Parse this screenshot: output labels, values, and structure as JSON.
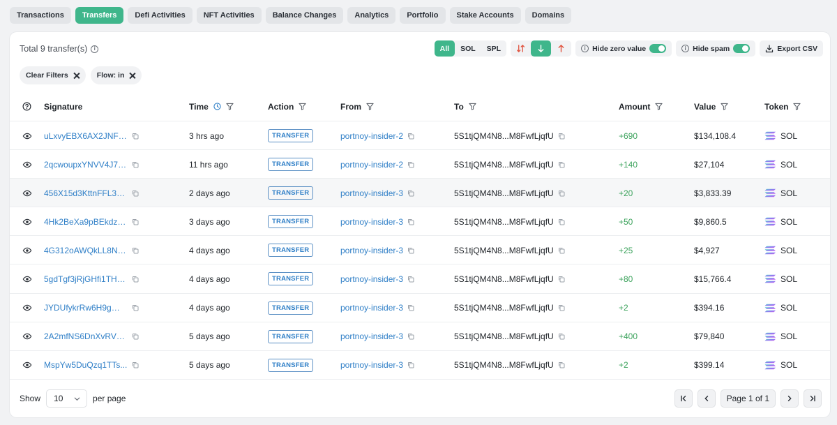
{
  "tabs": [
    {
      "label": "Transactions",
      "active": false
    },
    {
      "label": "Transfers",
      "active": true
    },
    {
      "label": "Defi Activities",
      "active": false
    },
    {
      "label": "NFT Activities",
      "active": false
    },
    {
      "label": "Balance Changes",
      "active": false
    },
    {
      "label": "Analytics",
      "active": false
    },
    {
      "label": "Portfolio",
      "active": false
    },
    {
      "label": "Stake Accounts",
      "active": false
    },
    {
      "label": "Domains",
      "active": false
    }
  ],
  "summary": {
    "total_text": "Total 9 transfer(s)"
  },
  "toolbar": {
    "token_filter": {
      "all": "All",
      "sol": "SOL",
      "spl": "SPL",
      "selected": "All"
    },
    "direction_selected": "in",
    "hide_zero_label": "Hide zero value",
    "hide_zero_on": true,
    "hide_spam_label": "Hide spam",
    "hide_spam_on": true,
    "export_label": "Export CSV"
  },
  "filters": {
    "clear_label": "Clear Filters",
    "active_filter": "Flow: in"
  },
  "table": {
    "headers": {
      "signature": "Signature",
      "time": "Time",
      "action": "Action",
      "from": "From",
      "to": "To",
      "amount": "Amount",
      "value": "Value",
      "token": "Token"
    },
    "rows": [
      {
        "signature": "uLxvyEBX6AX2JNFp...",
        "time": "3 hrs ago",
        "action": "TRANSFER",
        "from": "portnoy-insider-2",
        "to": "5S1tjQM4N8...M8FwfLjqfU",
        "amount": "+690",
        "value": "$134,108.4",
        "token": "SOL"
      },
      {
        "signature": "2qcwoupxYNVV4J7L...",
        "time": "11 hrs ago",
        "action": "TRANSFER",
        "from": "portnoy-insider-2",
        "to": "5S1tjQM4N8...M8FwfLjqfU",
        "amount": "+140",
        "value": "$27,104",
        "token": "SOL"
      },
      {
        "signature": "456X15d3KttnFFL3k...",
        "time": "2 days ago",
        "action": "TRANSFER",
        "from": "portnoy-insider-3",
        "to": "5S1tjQM4N8...M8FwfLjqfU",
        "amount": "+20",
        "value": "$3,833.39",
        "token": "SOL"
      },
      {
        "signature": "4Hk2BeXa9pBEkdzF...",
        "time": "3 days ago",
        "action": "TRANSFER",
        "from": "portnoy-insider-3",
        "to": "5S1tjQM4N8...M8FwfLjqfU",
        "amount": "+50",
        "value": "$9,860.5",
        "token": "SOL"
      },
      {
        "signature": "4G312oAWQkLL8NYi...",
        "time": "4 days ago",
        "action": "TRANSFER",
        "from": "portnoy-insider-3",
        "to": "5S1tjQM4N8...M8FwfLjqfU",
        "amount": "+25",
        "value": "$4,927",
        "token": "SOL"
      },
      {
        "signature": "5gdTgf3jRjGHfi1THs...",
        "time": "4 days ago",
        "action": "TRANSFER",
        "from": "portnoy-insider-3",
        "to": "5S1tjQM4N8...M8FwfLjqfU",
        "amount": "+80",
        "value": "$15,766.4",
        "token": "SOL"
      },
      {
        "signature": "JYDUfykrRw6H9gWv...",
        "time": "4 days ago",
        "action": "TRANSFER",
        "from": "portnoy-insider-3",
        "to": "5S1tjQM4N8...M8FwfLjqfU",
        "amount": "+2",
        "value": "$394.16",
        "token": "SOL"
      },
      {
        "signature": "2A2mfNS6DnXvRVFJ...",
        "time": "5 days ago",
        "action": "TRANSFER",
        "from": "portnoy-insider-3",
        "to": "5S1tjQM4N8...M8FwfLjqfU",
        "amount": "+400",
        "value": "$79,840",
        "token": "SOL"
      },
      {
        "signature": "MspYw5DuQzq1TTs...",
        "time": "5 days ago",
        "action": "TRANSFER",
        "from": "portnoy-insider-3",
        "to": "5S1tjQM4N8...M8FwfLjqfU",
        "amount": "+2",
        "value": "$399.14",
        "token": "SOL"
      }
    ]
  },
  "footer": {
    "show_label": "Show",
    "page_size": "10",
    "per_page_label": "per page",
    "page_info": "Page 1 of 1"
  },
  "colors": {
    "accent": "#3fb68b",
    "link": "#2f7fc7",
    "positive": "#3da35d"
  }
}
